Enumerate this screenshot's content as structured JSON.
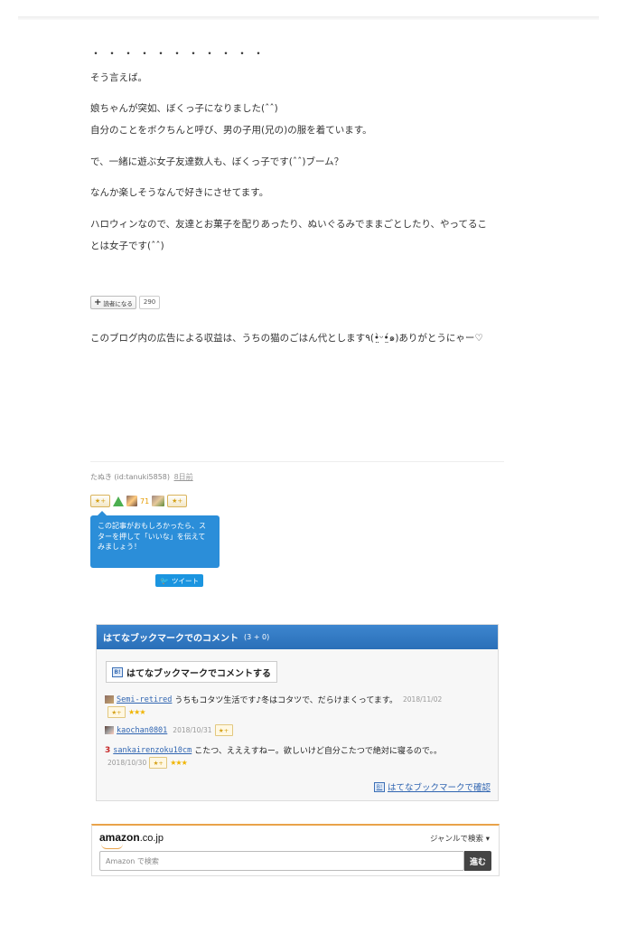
{
  "article": {
    "dots": "・・・・・・・・・・・",
    "p1": "そう言えば。",
    "p2": "娘ちゃんが突如、ぼくっ子になりました(ˆˆ)",
    "p3": "自分のことをボクちんと呼び、男の子用(兄の)の服を着ています。",
    "p4": "で、一緒に遊ぶ女子友達数人も、ぼくっ子です(ˆˆ)ブーム？",
    "p5": "なんか楽しそうなんで好きにさせてます。",
    "p6a": "ハロウィンなので、友達とお菓子を配りあったり、ぬいぐるみでままごとしたり、やってるこ",
    "p6b": "とは女子です(ˆˆ)"
  },
  "reader": {
    "button_label": "読者になる",
    "count": "290"
  },
  "ad_note": "このブログ内の広告による収益は、うちの猫のごはん代とします٩(•̤̀ᵕ•̤́๑)ありがとうにゃー♡",
  "author": {
    "name": "たぬき (id:tanuki5858)",
    "days_ago": "8日前"
  },
  "stars": {
    "add_label": "★+",
    "count": "71"
  },
  "tooltip": "この記事がおもしろかったら、スターを押して「いいな」を伝えてみましょう！",
  "tweet": {
    "label": "ツイート"
  },
  "hatena": {
    "header": "はてなブックマークでのコメント",
    "header_count": "(3 + 0)",
    "comment_button": "はてなブックマークでコメントする",
    "entries": [
      {
        "user": "Semi-retired",
        "text": "うちもコタツ生活です♪冬はコタツで、だらけまくってます。",
        "date": "2018/11/02",
        "stars": "★★★"
      },
      {
        "user": "kaochan0801",
        "text": "",
        "date": "2018/10/31",
        "stars": ""
      },
      {
        "user": "sankairenzoku10cm",
        "text": "こたつ、えええすねー。欲しいけど自分こたつで絶対に寝るので。。",
        "date": "2018/10/30",
        "stars": "★★★"
      }
    ],
    "star_add": "★+",
    "confirm_link": "はてなブックマークで確認",
    "rank_number": "3"
  },
  "amazon": {
    "logo": "amazon",
    "tld": ".co.jp",
    "genre": "ジャンルで検索 ▾",
    "placeholder": "Amazon で検索",
    "go": "進む"
  }
}
